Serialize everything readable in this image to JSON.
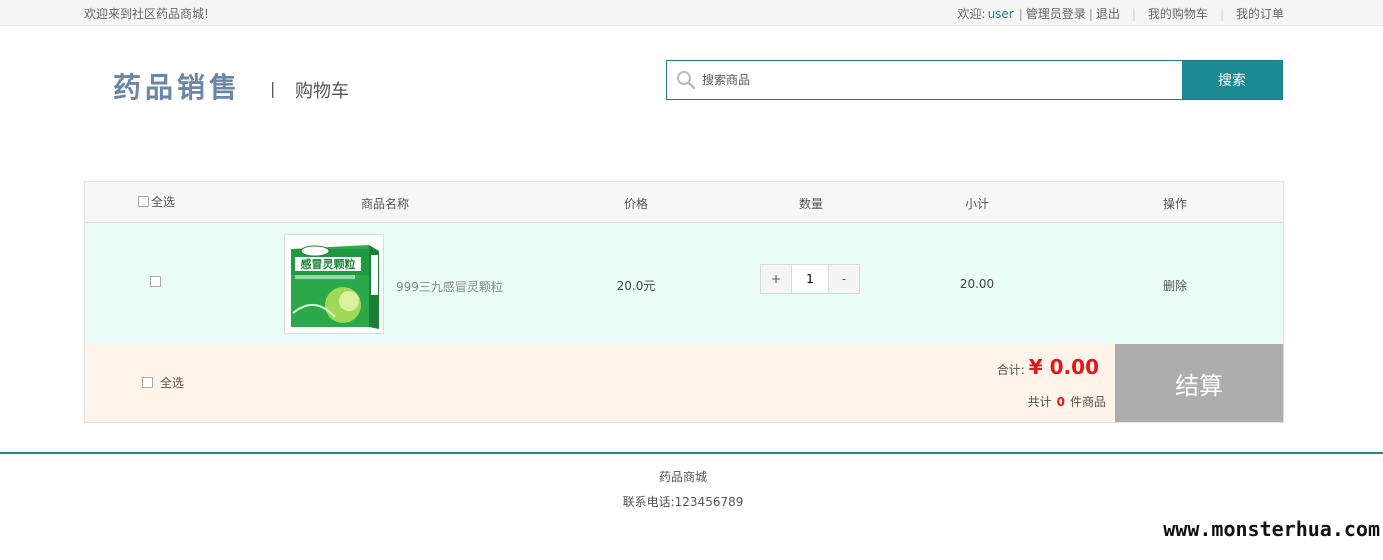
{
  "topbar": {
    "welcome": "欢迎来到社区药品商城!",
    "greeting": "欢迎:",
    "username": "user",
    "admin_login": "管理员登录",
    "logout": "退出",
    "my_cart": "我的购物车",
    "my_orders": "我的订单"
  },
  "header": {
    "logo_text": "药品销售",
    "separator": "|",
    "page_name": "购物车"
  },
  "search": {
    "placeholder": "搜索商品",
    "button_label": "搜索",
    "icon": "search-icon"
  },
  "cart_table": {
    "columns": {
      "select_all": "全选",
      "name": "商品名称",
      "price": "价格",
      "quantity": "数量",
      "subtotal": "小计",
      "action": "操作"
    },
    "items": [
      {
        "checked": false,
        "product_name": "999三九感冒灵颗粒",
        "image_label": "感冒灵颗粒",
        "price": "20.0元",
        "quantity": "1",
        "increment_label": "+",
        "decrement_label": "-",
        "subtotal": "20.00",
        "action": "删除"
      }
    ]
  },
  "cart_footer": {
    "select_all": "全选",
    "total_label": "合计:",
    "total_amount": "¥ 0.00",
    "count_prefix": "共计",
    "count": "0",
    "count_suffix": "件商品",
    "checkout_label": "结算"
  },
  "site_footer": {
    "name": "药品商城",
    "contact": "联系电话:123456789"
  },
  "watermark": "www.monsterhua.com",
  "colors": {
    "accent": "#1b8a92",
    "row_bg": "#e9fcf6",
    "footer_bg": "#fff3ea",
    "price_red": "#e4151b",
    "checkout_gray": "#adadad"
  }
}
